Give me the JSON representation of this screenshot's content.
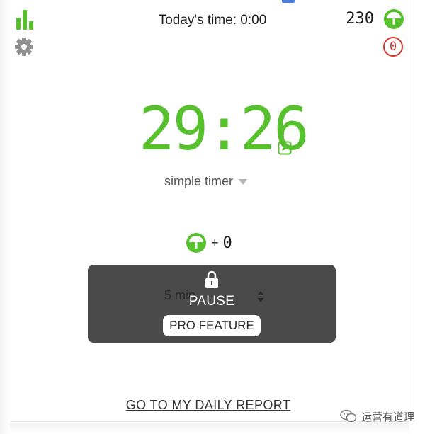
{
  "header": {
    "todays_time": "Today's time: 0:00",
    "coins": "230",
    "penalty_count": "0"
  },
  "timer": {
    "display": "29:26",
    "mode": "simple timer"
  },
  "reward": {
    "plus": "+",
    "value": "0"
  },
  "pro_panel": {
    "duration": "5 min",
    "pause_label": "PAUSE",
    "pro_button": "PRO FEATURE"
  },
  "footer": {
    "daily_report_link": "GO TO MY DAILY REPORT",
    "watermark_text": "运营有道理"
  },
  "icons": {
    "stats": "bar-chart-icon",
    "settings": "gear-icon",
    "coin": "tree-coin-icon",
    "edit": "edit-icon",
    "lock": "lock-icon",
    "watermark": "wechat-icon"
  },
  "colors": {
    "accent_green": "#56c12c",
    "danger_red": "#d8372f",
    "panel_gray": "#4a4a4a"
  }
}
